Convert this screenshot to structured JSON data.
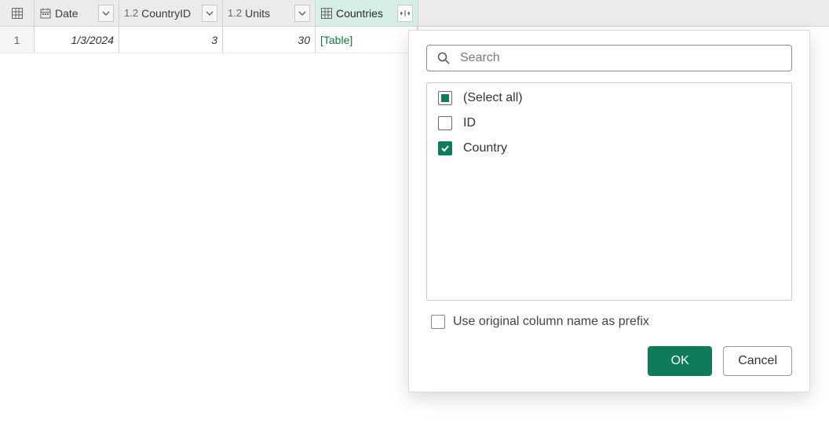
{
  "columns": {
    "date": {
      "label": "Date"
    },
    "countryId": {
      "label": "CountryID",
      "typeHint": "1.2"
    },
    "units": {
      "label": "Units",
      "typeHint": "1.2"
    },
    "countries": {
      "label": "Countries"
    }
  },
  "rows": {
    "r0": {
      "index": "1",
      "date": "1/3/2024",
      "countryId": "3",
      "units": "30",
      "countries": "[Table]"
    }
  },
  "popup": {
    "searchPlaceholder": "Search",
    "options": {
      "selectAll": "(Select all)",
      "id": "ID",
      "country": "Country"
    },
    "prefixLabel": "Use original column name as prefix",
    "okLabel": "OK",
    "cancelLabel": "Cancel"
  }
}
